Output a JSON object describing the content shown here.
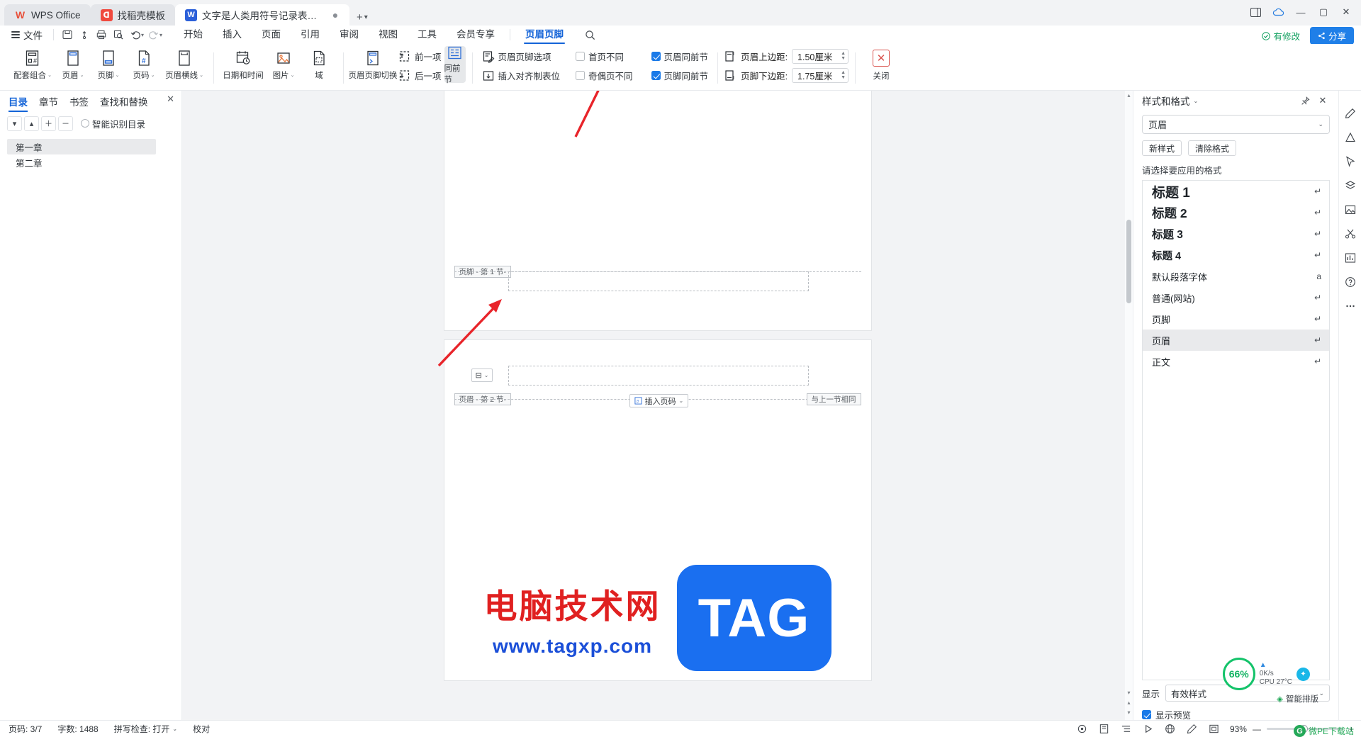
{
  "window": {
    "tabs": [
      {
        "label": "WPS Office",
        "icon": "wps-logo-icon",
        "style": "grey"
      },
      {
        "label": "找稻壳模板",
        "icon": "dock-template-icon",
        "style": "grey"
      },
      {
        "label": "文字是人类用符号记录表达信息以…",
        "icon": "word-doc-icon",
        "style": "active",
        "dot": "●"
      }
    ],
    "new_tab": "+",
    "controls": {
      "sidebar": "⬓",
      "cloud": "☁",
      "minimize": "—",
      "maximize": "▢",
      "close": "✕"
    }
  },
  "menubar": {
    "file_label": "文件",
    "quick": [
      "save-icon",
      "cloud-sync-icon",
      "print-icon",
      "print-preview-icon",
      "undo-icon",
      "redo-icon",
      "more-icon"
    ],
    "tabs": [
      {
        "label": "开始",
        "active": false
      },
      {
        "label": "插入",
        "active": false
      },
      {
        "label": "页面",
        "active": false
      },
      {
        "label": "引用",
        "active": false
      },
      {
        "label": "审阅",
        "active": false
      },
      {
        "label": "视图",
        "active": false
      },
      {
        "label": "工具",
        "active": false
      },
      {
        "label": "会员专享",
        "active": false
      },
      {
        "label": "页眉页脚",
        "active": true
      }
    ],
    "search_icon": "search-icon",
    "saved_status": "有修改",
    "share_label": "分享"
  },
  "ribbon": {
    "group1": [
      {
        "label": "配套组合",
        "icon": "header-footer-combo-icon",
        "caret": "⌄"
      },
      {
        "label": "页眉",
        "icon": "header-icon",
        "caret": "⌄"
      },
      {
        "label": "页脚",
        "icon": "footer-icon",
        "caret": "⌄"
      },
      {
        "label": "页码",
        "icon": "page-number-icon",
        "caret": "⌄"
      },
      {
        "label": "页眉横线",
        "icon": "header-line-icon",
        "caret": "⌄"
      }
    ],
    "group2": [
      {
        "label": "日期和时间",
        "icon": "date-time-icon"
      },
      {
        "label": "图片",
        "icon": "picture-icon",
        "caret": "⌄"
      },
      {
        "label": "域",
        "icon": "field-icon"
      }
    ],
    "group3": {
      "switch": {
        "label": "页眉页脚切换",
        "icon": "header-footer-switch-icon"
      },
      "prev": {
        "label": "前一项",
        "icon": "previous-section-icon"
      },
      "next": {
        "label": "后一项",
        "icon": "next-section-icon"
      },
      "same_as_prev": {
        "label": "同前节",
        "icon": "same-as-previous-icon",
        "active": true
      }
    },
    "group4": {
      "options": {
        "label": "页眉页脚选项",
        "icon": "header-footer-options-icon"
      },
      "align_tab": {
        "label": "插入对齐制表位",
        "icon": "insert-alignment-tab-icon"
      },
      "checkboxes": [
        {
          "label": "首页不同",
          "checked": false
        },
        {
          "label": "奇偶页不同",
          "checked": false
        },
        {
          "label": "页眉同前节",
          "checked": true
        },
        {
          "label": "页脚同前节",
          "checked": true
        }
      ]
    },
    "group5": [
      {
        "label": "页眉上边距:",
        "value": "1.50厘米",
        "icon": "header-top-margin-icon"
      },
      {
        "label": "页脚下边距:",
        "value": "1.75厘米",
        "icon": "footer-bottom-margin-icon"
      }
    ],
    "close": {
      "label": "关闭",
      "icon": "close-header-footer-icon"
    }
  },
  "left_panel": {
    "tabs": [
      {
        "label": "目录",
        "active": true
      },
      {
        "label": "章节",
        "active": false
      },
      {
        "label": "书签",
        "active": false
      },
      {
        "label": "查找和替换",
        "active": false
      }
    ],
    "close_icon": "close-icon",
    "tools": [
      "collapse-all-icon",
      "move-up-icon",
      "promote-icon",
      "demote-icon"
    ],
    "smart_toc": "智能识别目录",
    "toc_items": [
      {
        "label": "第一章",
        "selected": true
      },
      {
        "label": "第二章",
        "selected": false
      }
    ]
  },
  "document": {
    "page1": {
      "footer_mark": "页脚 - 第 1 节-"
    },
    "page2": {
      "header_mark": "页眉 - 第 2 节-",
      "same_as_prev_mark": "与上一节相同",
      "insert_page_number": "插入页码",
      "insert_page_number_caret": "⌄",
      "content_control": "⊟",
      "content_control_caret": "⌄"
    }
  },
  "watermark": {
    "cn": "电脑技术网",
    "url": "www.tagxp.com",
    "tag": "TAG"
  },
  "right_panel": {
    "title": "样式和格式",
    "title_caret": "⌄",
    "pin_icon": "pin-icon",
    "close_icon": "close-icon",
    "selected_style": "页眉",
    "select_caret": "⌄",
    "buttons": [
      "新样式",
      "清除格式"
    ],
    "list_label": "请选择要应用的格式",
    "styles": [
      {
        "label": "标题 1",
        "cls": "s1",
        "mark": "↵",
        "selected": false
      },
      {
        "label": "标题 2",
        "cls": "s2",
        "mark": "↵",
        "selected": false
      },
      {
        "label": "标题 3",
        "cls": "s3",
        "mark": "↵",
        "selected": false
      },
      {
        "label": "标题 4",
        "cls": "s4",
        "mark": "↵",
        "selected": false
      },
      {
        "label": "默认段落字体",
        "cls": "sn",
        "mark": "a",
        "selected": false
      },
      {
        "label": "普通(网站)",
        "cls": "sn",
        "mark": "↵",
        "selected": false
      },
      {
        "label": "页脚",
        "cls": "sn",
        "mark": "↵",
        "selected": false
      },
      {
        "label": "页眉",
        "cls": "sn",
        "mark": "↵",
        "selected": true
      },
      {
        "label": "正文",
        "cls": "sn",
        "mark": "↵",
        "selected": false
      }
    ],
    "footer": {
      "show_label": "显示",
      "show_value": "有效样式",
      "show_caret": "⌄",
      "preview_label": "显示预览",
      "preview_checked": true
    }
  },
  "rail_icons": [
    "pen-icon",
    "shape-icon",
    "cursor-icon",
    "layers-icon",
    "picture-frame-icon",
    "scissors-icon",
    "chart-icon",
    "help-icon",
    "more-icon"
  ],
  "float": {
    "cpu_percent": "66%",
    "net_speed": "0K/s",
    "cpu_temp": "CPU 27°C",
    "smart_label": "智能排版",
    "up_arrow": "↑",
    "down_arrow": "↓"
  },
  "statusbar": {
    "page": "页码: 3/7",
    "words": "字数: 1488",
    "spellcheck": "拼写检查: 打开",
    "spellcheck_caret": "⌄",
    "proof": "校对",
    "icons": [
      "record-icon",
      "page-view-icon",
      "outline-view-icon",
      "read-view-icon",
      "web-view-icon",
      "pen-icon",
      "fullscreen-icon"
    ],
    "zoom_value": "93%",
    "zoom_minus": "—",
    "zoom_plus": "+",
    "site_logo": "微PE下载站",
    "site_badge": "G"
  }
}
